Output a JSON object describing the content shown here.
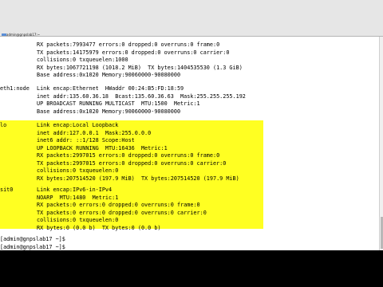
{
  "window": {
    "title": "admin@gnpslab17:~"
  },
  "terminal": {
    "top_lines": [
      "RX packets:7993477 errors:0 dropped:0 overruns:0 frame:0",
      "TX packets:14175979 errors:0 dropped:0 overruns:0 carrier:0",
      "collisions:0 txqueuelen:1000",
      "RX bytes:1067721198 (1018.2 MiB)  TX bytes:1404535530 (1.3 GiB)",
      "Base address:0x1020 Memory:90060000-90080000"
    ],
    "eth1": {
      "name": "eth1:node",
      "lines": [
        "Link encap:Ethernet  HWaddr 00:24:B5:FD:18:59",
        "inet addr:135.60.36.18  Bcast:135.60.36.63  Mask:255.255.255.192",
        "UP BROADCAST RUNNING MULTICAST  MTU:1500  Metric:1",
        "Base address:0x1020 Memory:90060000-90080000"
      ]
    },
    "lo": {
      "name": "lo",
      "highlight_color": "#ffff22",
      "lines": [
        "Link encap:Local Loopback",
        "inet addr:127.0.0.1  Mask:255.0.0.0",
        "inet6 addr: ::1/128 Scope:Host",
        "UP LOOPBACK RUNNING  MTU:16436  Metric:1",
        "RX packets:2997015 errors:0 dropped:0 overruns:0 frame:0",
        "TX packets:2997015 errors:0 dropped:0 overruns:0 carrier:0",
        "collisions:0 txqueuelen:0",
        "RX bytes:207514520 (197.9 MiB)  TX bytes:207514520 (197.9 MiB)"
      ]
    },
    "sit0": {
      "name": "sit0",
      "lines": [
        "Link encap:IPv6-in-IPv4",
        "NOARP  MTU:1480  Metric:1",
        "RX packets:0 errors:0 dropped:0 overruns:0 frame:0",
        "TX packets:0 errors:0 dropped:0 overruns:0 carrier:0",
        "collisions:0 txqueuelen:0",
        "RX bytes:0 (0.0 b)  TX bytes:0 (0.0 b)"
      ]
    },
    "prompts": [
      "[admin@gnpslab17 ~]$",
      "[admin@gnpslab17 ~]$"
    ]
  }
}
